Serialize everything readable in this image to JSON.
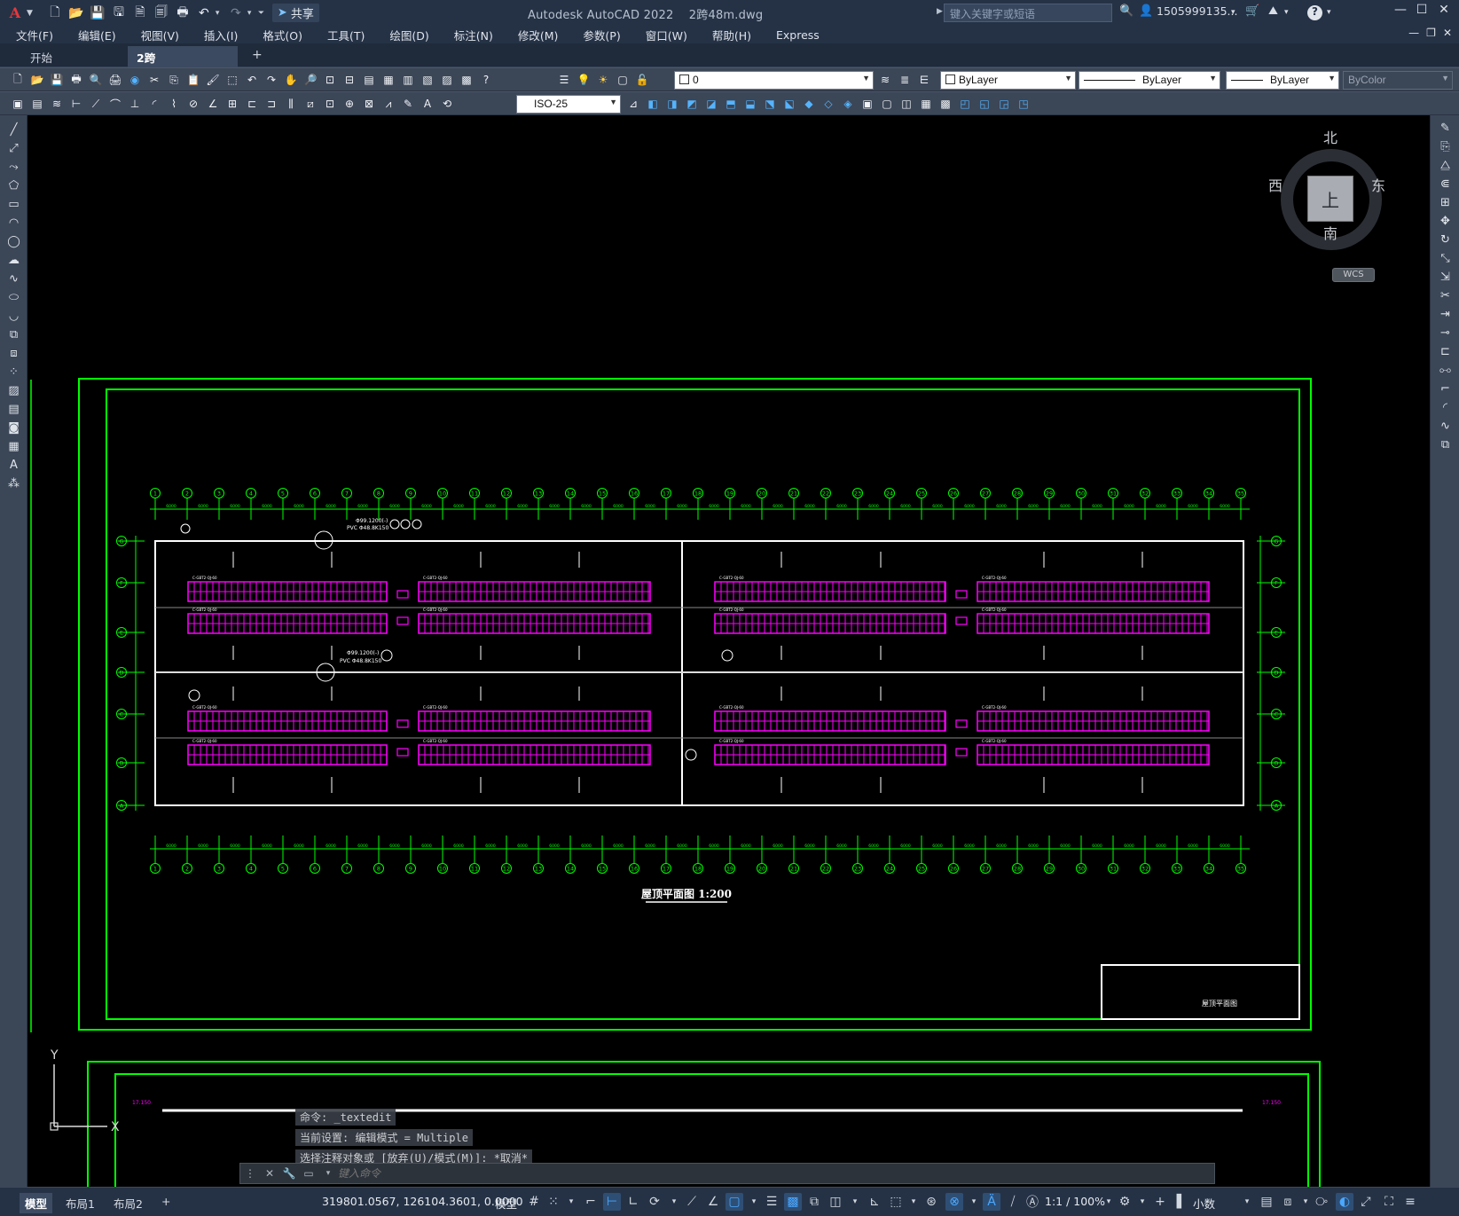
{
  "app": {
    "logo": "A",
    "title": "Autodesk AutoCAD 2022",
    "filename": "2跨48m.dwg",
    "share_label": "共享",
    "search_placeholder": "键入关键字或短语",
    "user": "1505999135...",
    "help": "?"
  },
  "menu": [
    "文件(F)",
    "编辑(E)",
    "视图(V)",
    "插入(I)",
    "格式(O)",
    "工具(T)",
    "绘图(D)",
    "标注(N)",
    "修改(M)",
    "参数(P)",
    "窗口(W)",
    "帮助(H)",
    "Express"
  ],
  "tabs": {
    "start": "开始",
    "active": "2跨48m*",
    "close": "✕",
    "add": "+"
  },
  "properties": {
    "layer": "0",
    "color": "ByLayer",
    "linetype": "ByLayer",
    "lineweight": "ByLayer",
    "plotstyle": "ByColor",
    "dimstyle": "ISO-25"
  },
  "viewcube": {
    "north": "北",
    "south": "南",
    "east": "东",
    "west": "西",
    "face": "上",
    "wcs": "WCS"
  },
  "ucs": {
    "y": "Y",
    "x": "X"
  },
  "drawing": {
    "title": "屋顶平面图 1:200",
    "titleblock": "屋顶平面图",
    "axis_numbers": [
      "1",
      "2",
      "3",
      "4",
      "5",
      "6",
      "7",
      "8",
      "9",
      "10",
      "11",
      "12",
      "13",
      "14",
      "15",
      "16",
      "17",
      "18",
      "19",
      "20",
      "21",
      "22",
      "23",
      "24",
      "25",
      "26",
      "27",
      "28",
      "29",
      "30",
      "31",
      "32",
      "33",
      "34",
      "35"
    ],
    "row_letters": [
      "A",
      "B",
      "C",
      "D",
      "E",
      "F",
      "G"
    ],
    "dim_text": "6000",
    "panel_label": "C-GBT2-QJ-60",
    "pipe_note": "Φ99.1200(-)",
    "pvc_note": "PVC Φ48.8K150",
    "elev_note": "17.150"
  },
  "command": {
    "history": [
      "命令: _textedit",
      "当前设置: 编辑模式 = Multiple",
      "选择注释对象或 [放弃(U)/模式(M)]: *取消*"
    ],
    "placeholder": "键入命令"
  },
  "layouts": [
    "模型",
    "布局1",
    "布局2"
  ],
  "status": {
    "coords": "319801.0567, 126104.3601, 0.0000",
    "model": "模型",
    "scale": "1:1 / 100%",
    "units": "小数"
  },
  "colors": {
    "green": "#00ff00",
    "magenta": "#ff00ff",
    "white": "#ffffff",
    "ui_dark": "#253246",
    "ui_toolbar": "#3b4657"
  }
}
